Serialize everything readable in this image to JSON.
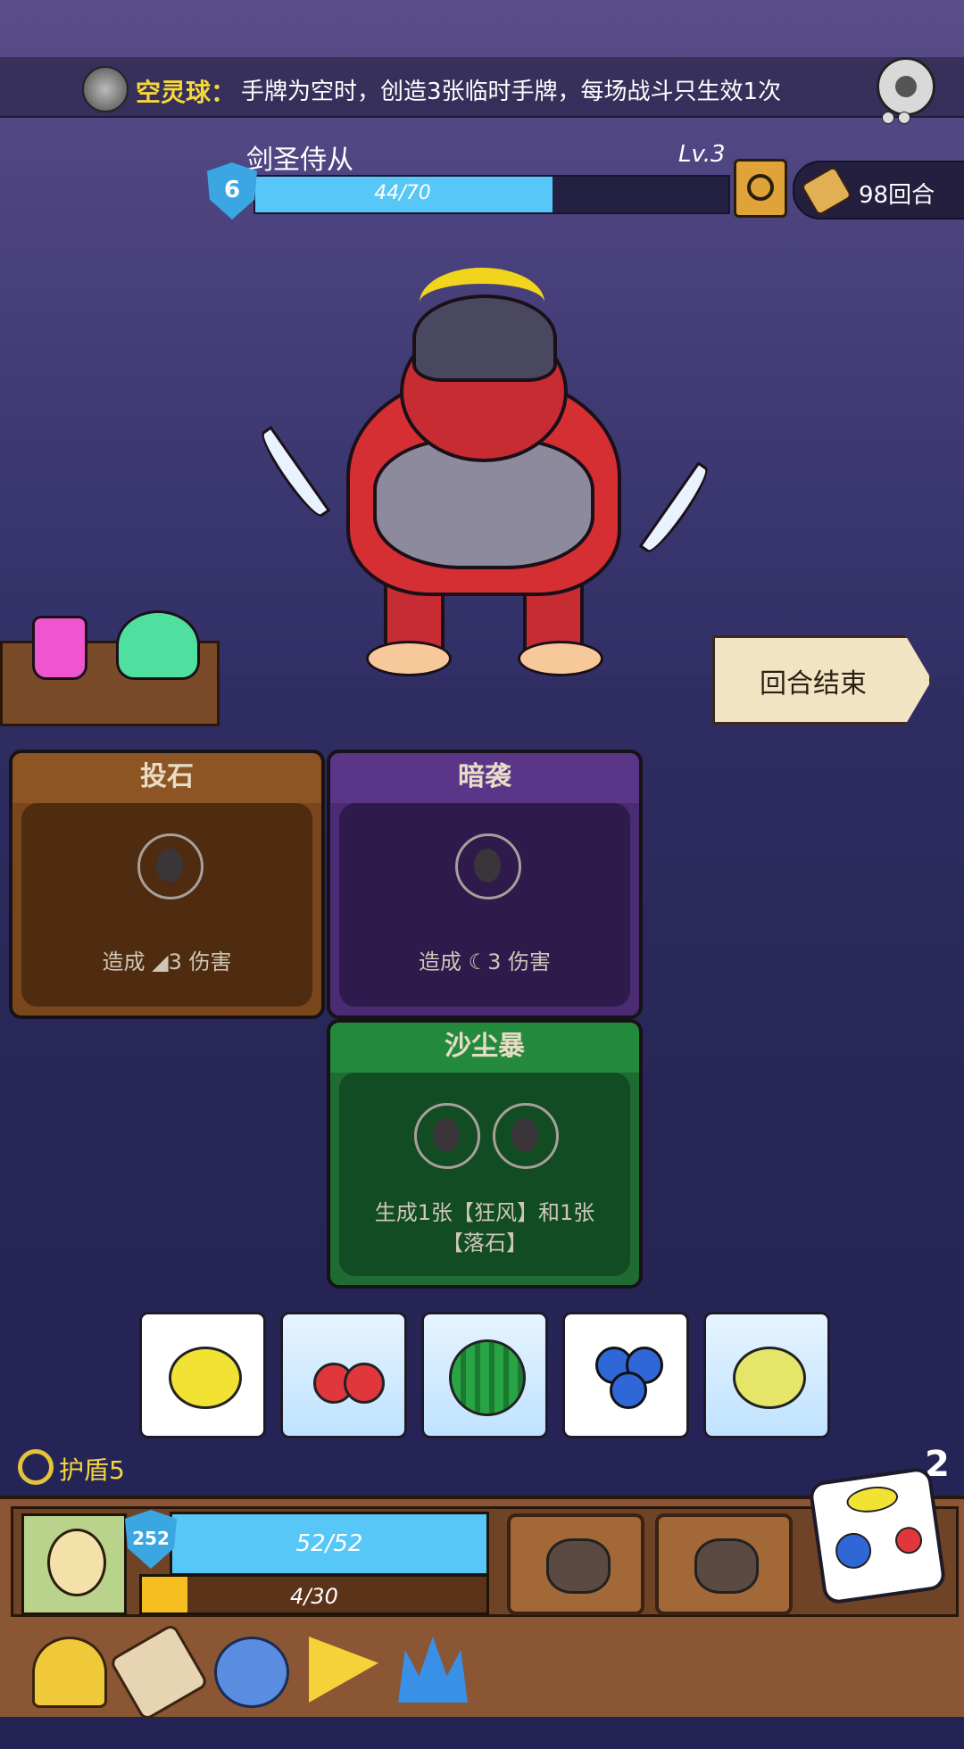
{
  "top_relic": {
    "name": "空灵球：",
    "description": "手牌为空时，创造3张临时手牌，每场战斗只生效1次"
  },
  "enemy": {
    "name": "剑圣侍从",
    "level": "Lv.3",
    "shield": "6",
    "hp_text": "44/70",
    "hp_ratio": 0.629,
    "turns": "98回合"
  },
  "end_turn": "回合结束",
  "cards": [
    {
      "title": "投石",
      "text": "造成 ◢3 伤害",
      "color": "#7a461b"
    },
    {
      "title": "暗袭",
      "text": "造成 ☾3 伤害",
      "color": "#4b2b74"
    },
    {
      "title": "沙尘暴",
      "text": "生成1张【狂风】和1张【落石】",
      "color": "#1e6b33"
    }
  ],
  "dice": [
    {
      "fruit": "lemon",
      "frozen": false
    },
    {
      "fruit": "cherry",
      "frozen": true
    },
    {
      "fruit": "watermelon",
      "frozen": true
    },
    {
      "fruit": "blueberry",
      "frozen": false
    },
    {
      "fruit": "lemon",
      "frozen": true
    }
  ],
  "player": {
    "shield_label": "护盾5",
    "shield_value": "252",
    "hp_text": "52/52",
    "xp_text": "4/30",
    "xp_ratio": 0.133,
    "reroll_count": "2"
  },
  "skills": [
    "spiked-fist-icon",
    "shovel-icon"
  ],
  "relics": [
    "helmet-icon",
    "scroll-icon",
    "blob-icon",
    "cheese-icon",
    "crown-icon"
  ]
}
